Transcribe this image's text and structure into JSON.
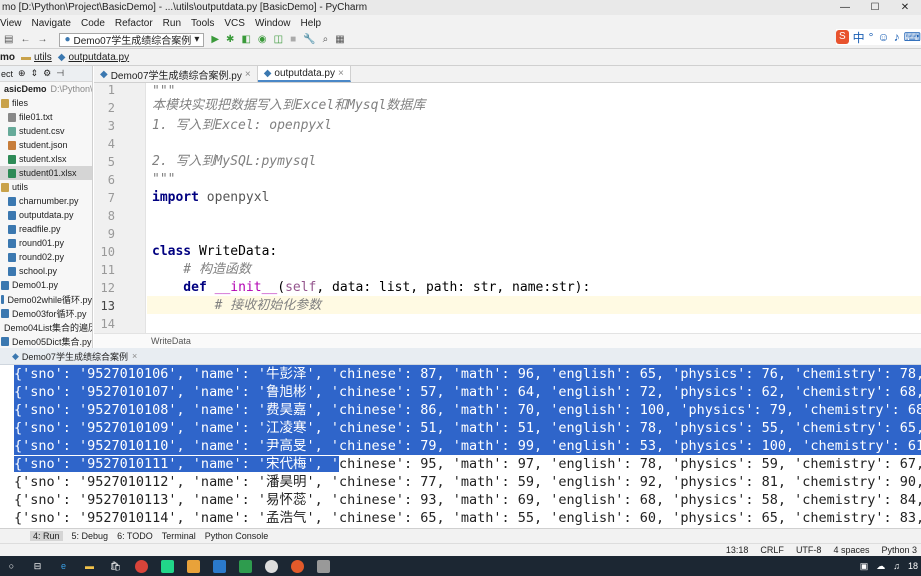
{
  "titlebar": {
    "text": "mo [D:\\Python\\Project\\BasicDemo] - ...\\utils\\outputdata.py [BasicDemo] - PyCharm",
    "min": "—",
    "max": "☐",
    "close": "✕"
  },
  "menu": [
    "View",
    "Navigate",
    "Code",
    "Refactor",
    "Run",
    "Tools",
    "VCS",
    "Window",
    "Help"
  ],
  "toolbar": {
    "run_config": "Demo07学生成绩综合案例",
    "ime_label": "中"
  },
  "navbar": {
    "project": "mo",
    "folder": "utils",
    "file": "outputdata.py"
  },
  "sidebar": {
    "header": "ect",
    "items": [
      {
        "label": "asicDemo",
        "extra": "D:\\Python\\Pro",
        "indent": 0,
        "icon": "folder",
        "bold": true
      },
      {
        "label": "files",
        "indent": 0,
        "icon": "folder"
      },
      {
        "label": "file01.txt",
        "indent": 1,
        "icon": "txt"
      },
      {
        "label": "student.csv",
        "indent": 1,
        "icon": "csv"
      },
      {
        "label": "student.json",
        "indent": 1,
        "icon": "json"
      },
      {
        "label": "student.xlsx",
        "indent": 1,
        "icon": "xlsx"
      },
      {
        "label": "student01.xlsx",
        "indent": 1,
        "icon": "xlsx",
        "selected": true
      },
      {
        "label": "utils",
        "indent": 0,
        "icon": "folder"
      },
      {
        "label": "charnumber.py",
        "indent": 1,
        "icon": "py"
      },
      {
        "label": "outputdata.py",
        "indent": 1,
        "icon": "py"
      },
      {
        "label": "readfile.py",
        "indent": 1,
        "icon": "py"
      },
      {
        "label": "round01.py",
        "indent": 1,
        "icon": "py"
      },
      {
        "label": "round02.py",
        "indent": 1,
        "icon": "py"
      },
      {
        "label": "school.py",
        "indent": 1,
        "icon": "py"
      },
      {
        "label": "Demo01.py",
        "indent": 0,
        "icon": "py"
      },
      {
        "label": "Demo02while循环.py",
        "indent": 0,
        "icon": "py"
      },
      {
        "label": "Demo03for循环.py",
        "indent": 0,
        "icon": "py"
      },
      {
        "label": "Demo04List集合的遍历.p",
        "indent": 0,
        "icon": "py"
      },
      {
        "label": "Demo05Dict集合.py",
        "indent": 0,
        "icon": "py"
      }
    ]
  },
  "editor_tabs": [
    {
      "label": "Demo07学生成绩综合案例.py",
      "active": false
    },
    {
      "label": "outputdata.py",
      "active": true
    }
  ],
  "code": {
    "line_numbers": [
      "1",
      "2",
      "3",
      "4",
      "5",
      "6",
      "7",
      "8",
      "9",
      "10",
      "11",
      "12",
      "13",
      "14"
    ],
    "l1": "\"\"\"",
    "l2": "本模块实现把数据写入到Excel和Mysql数据库",
    "l3": "1. 写入到Excel: openpyxl",
    "l5": "2. 写入到MySQL:pymysql",
    "l6": "\"\"\"",
    "l7_kw": "import",
    "l7_rest": " openpyxl",
    "l10_kw": "class",
    "l10_rest": " WriteData:",
    "l11": "    # 构造函数",
    "l12_kw": "    def",
    "l12_fn": " __init__",
    "l12_open": "(",
    "l12_self": "self",
    "l12_rest": ", data: list, path: str, name:str):",
    "l13": "        # 接收初始化参数"
  },
  "breadcrumb": "WriteData",
  "run_tab": "Demo07学生成绩综合案例",
  "console": {
    "rows": [
      {
        "sel": "{'sno",
        "rest": "': '9527010106', 'name': '牛彭泽', 'chinese': 87, 'math': 96, 'english': 65, 'physics': 76, 'chemistry': 78,",
        "full_select": true
      },
      {
        "sel": "{'sno': '9527010107', 'name': '鲁旭彬', 'chinese': 57, 'math': 64, 'english': 72, 'physics': 62, 'chemistry': 68,",
        "rest": "",
        "full_select": true
      },
      {
        "sel": "{'sno': '9527010108', 'name': '费昊嘉', 'chinese': 86, 'math': 70, 'english': 100, 'physics': 79, 'chemistry': 68,",
        "rest": "",
        "full_select": true
      },
      {
        "sel": "{'sno': '9527010109', 'name': '江凌寒', 'chinese': 51, 'math': 51, 'english': 78, 'physics': 55, 'chemistry': 65,",
        "rest": "",
        "full_select": true
      },
      {
        "sel": "{'sno': '9527010110', 'name': '尹高旻', 'chinese': 79, 'math': 99, 'english': 53, 'physics': 100, 'chemistry': 61,",
        "rest": "",
        "full_select": true
      },
      {
        "sel": "{'sno': '9527010111', 'name': '宋代梅', '",
        "rest": "chinese': 95, 'math': 97, 'english': 78, 'physics': 59, 'chemistry': 67,",
        "full_select": false
      },
      {
        "sel": "",
        "rest": "{'sno': '9527010112', 'name': '潘昊明', 'chinese': 77, 'math': 59, 'english': 92, 'physics': 81, 'chemistry': 90,",
        "full_select": false
      },
      {
        "sel": "",
        "rest": "{'sno': '9527010113', 'name': '易怀蕊', 'chinese': 93, 'math': 69, 'english': 68, 'physics': 58, 'chemistry': 84,",
        "full_select": false
      },
      {
        "sel": "",
        "rest": "{'sno': '9527010114', 'name': '孟浩气', 'chinese': 65, 'math': 55, 'english': 60, 'physics': 65, 'chemistry': 83,",
        "full_select": false
      }
    ]
  },
  "toolwindows": [
    "4: Run",
    "5: Debug",
    "6: TODO",
    "Terminal",
    "Python Console"
  ],
  "status": {
    "position": "13:18",
    "line_sep": "CRLF",
    "encoding": "UTF-8",
    "indent": "4 spaces",
    "interp": "Python 3"
  },
  "taskbar": {
    "time": "18"
  }
}
